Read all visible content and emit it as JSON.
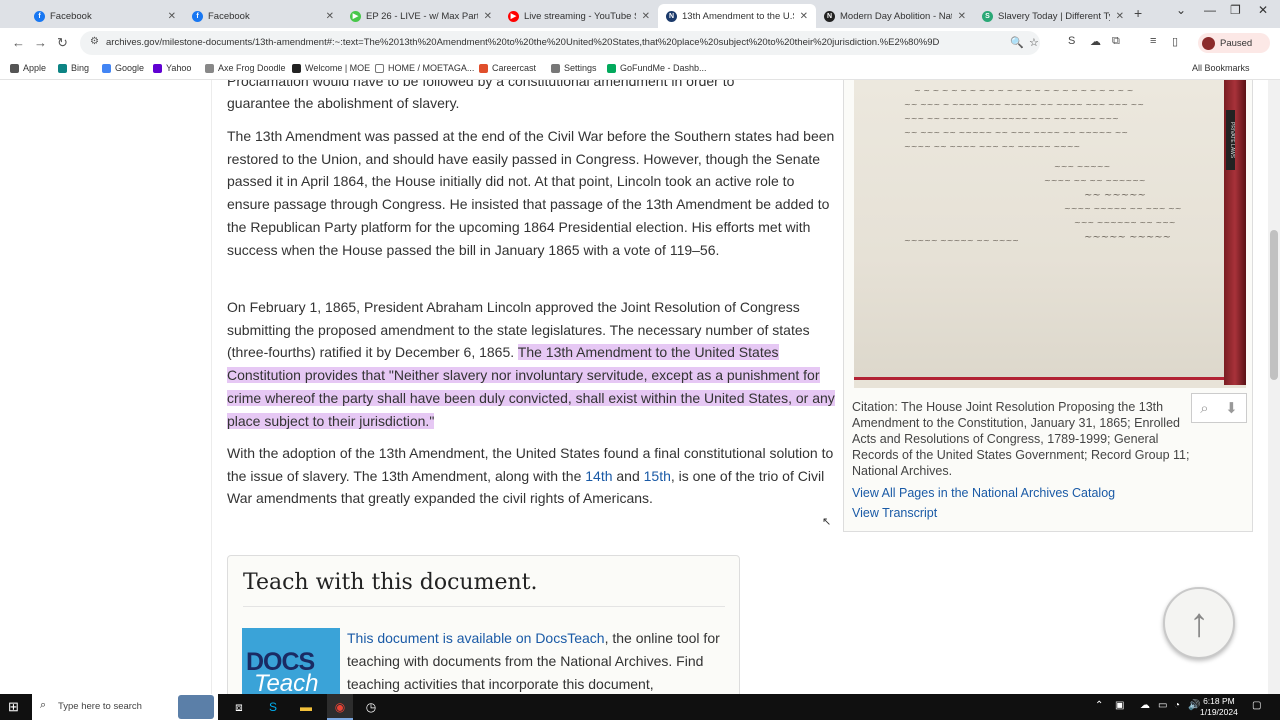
{
  "browser": {
    "tabs": [
      {
        "title": "Facebook",
        "favicon_color": "#1877f2",
        "favicon_glyph": "f"
      },
      {
        "title": "Facebook",
        "favicon_color": "#1877f2",
        "favicon_glyph": "f"
      },
      {
        "title": "EP 26 - LIVE - w/ Max Parthas –",
        "favicon_color": "#47c74a",
        "favicon_glyph": "▶"
      },
      {
        "title": "Live streaming - YouTube Studi",
        "favicon_color": "#ff0000",
        "favicon_glyph": "▶"
      },
      {
        "title": "13th Amendment to the U.S. C",
        "favicon_color": "#1b3a6b",
        "favicon_glyph": "N",
        "active": true
      },
      {
        "title": "Modern Day Abolition - Nation",
        "favicon_color": "#222222",
        "favicon_glyph": "N"
      },
      {
        "title": "Slavery Today | Different Types",
        "favicon_color": "#2aa876",
        "favicon_glyph": "S"
      }
    ],
    "url": "archives.gov/milestone-documents/13th-amendment#:~:text=The%2013th%20Amendment%20to%20the%20United%20States,that%20place%20subject%20to%20their%20jurisdiction.%E2%80%9D",
    "profile_label": "Paused",
    "bookmarks": [
      {
        "label": "Apple",
        "color": "#555555"
      },
      {
        "label": "Bing",
        "color": "#0c8484"
      },
      {
        "label": "Google",
        "color": "#4285f4"
      },
      {
        "label": "Yahoo",
        "color": "#6001d2"
      },
      {
        "label": "Axe Frog Doodle",
        "color": "#888888"
      },
      {
        "label": "Welcome | MOE",
        "color": "#222222"
      },
      {
        "label": "HOME / MOETAGA...",
        "color": "#777777"
      },
      {
        "label": "Careercast",
        "color": "#e04e2b"
      },
      {
        "label": "Settings",
        "color": "#777777"
      },
      {
        "label": "GoFundMe - Dashb...",
        "color": "#02a95c"
      }
    ],
    "all_bookmarks": "All Bookmarks"
  },
  "article": {
    "p0": "guarantee the abolishment of slavery.",
    "p0_prev": "Proclamation would have to be followed by a constitutional amendment in order to",
    "p1": "The 13th Amendment was passed at the end of the Civil War before the Southern states had been restored to the Union, and should have easily passed in Congress. However, though the Senate passed it in April 1864, the House initially did not. At that point, Lincoln took an active role to ensure passage through Congress. He insisted that passage of the 13th Amendment be added to the Republican Party platform for the upcoming 1864 Presidential election. His efforts met with success when the House passed the bill in January 1865 with a vote of 119–56.",
    "p2_plain": "On February 1, 1865, President Abraham Lincoln approved the Joint Resolution of Congress submitting the proposed amendment to the state legislatures. The necessary number of states (three-fourths) ratified it by December 6, 1865. ",
    "p2_highlight": "The 13th Amendment to the United States Constitution provides that \"Neither slavery nor involuntary servitude, except as a punishment for crime whereof the party shall have been duly convicted, shall exist within the United States, or any place subject to their jurisdiction.\"",
    "p3_a": "With the adoption of the 13th Amendment, the United States found a final constitutional solution to the issue of slavery. The 13th Amendment, along with the ",
    "p3_link1": "14th",
    "p3_b": " and ",
    "p3_link2": "15th",
    "p3_c": ", is one of the trio of Civil War amendments that greatly expanded the civil rights of Americans."
  },
  "sidebar": {
    "scan_tab_label": "PRIVATE LAWS",
    "citation": "Citation: The House Joint Resolution Proposing the 13th Amendment to the Constitution, January 31, 1865; Enrolled Acts and Resolutions of Congress, 1789-1999; General Records of the United States Government; Record Group 11; National Archives.",
    "link_catalog": "View All Pages in the National Archives Catalog",
    "link_transcript": "View Transcript"
  },
  "teach": {
    "heading": "Teach with this document.",
    "logo_line1": "DOCS",
    "logo_line2": "Teach",
    "link": "This document is available on DocsTeach",
    "text": ", the online tool for teaching with documents from the National Archives. Find teaching activities that incorporate this document,"
  },
  "taskbar": {
    "search_placeholder": "Type here to search",
    "time": "6:18 PM",
    "date": "1/19/2024"
  }
}
